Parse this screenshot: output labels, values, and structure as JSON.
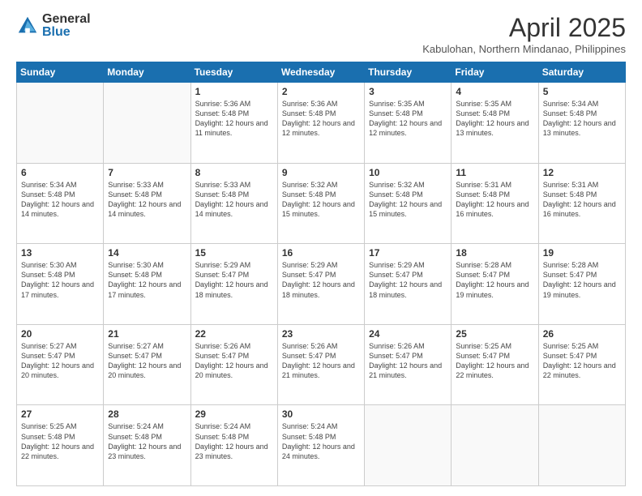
{
  "logo": {
    "general": "General",
    "blue": "Blue"
  },
  "title": "April 2025",
  "location": "Kabulohan, Northern Mindanao, Philippines",
  "days_of_week": [
    "Sunday",
    "Monday",
    "Tuesday",
    "Wednesday",
    "Thursday",
    "Friday",
    "Saturday"
  ],
  "weeks": [
    [
      {
        "day": "",
        "info": ""
      },
      {
        "day": "",
        "info": ""
      },
      {
        "day": "1",
        "info": "Sunrise: 5:36 AM\nSunset: 5:48 PM\nDaylight: 12 hours and 11 minutes."
      },
      {
        "day": "2",
        "info": "Sunrise: 5:36 AM\nSunset: 5:48 PM\nDaylight: 12 hours and 12 minutes."
      },
      {
        "day": "3",
        "info": "Sunrise: 5:35 AM\nSunset: 5:48 PM\nDaylight: 12 hours and 12 minutes."
      },
      {
        "day": "4",
        "info": "Sunrise: 5:35 AM\nSunset: 5:48 PM\nDaylight: 12 hours and 13 minutes."
      },
      {
        "day": "5",
        "info": "Sunrise: 5:34 AM\nSunset: 5:48 PM\nDaylight: 12 hours and 13 minutes."
      }
    ],
    [
      {
        "day": "6",
        "info": "Sunrise: 5:34 AM\nSunset: 5:48 PM\nDaylight: 12 hours and 14 minutes."
      },
      {
        "day": "7",
        "info": "Sunrise: 5:33 AM\nSunset: 5:48 PM\nDaylight: 12 hours and 14 minutes."
      },
      {
        "day": "8",
        "info": "Sunrise: 5:33 AM\nSunset: 5:48 PM\nDaylight: 12 hours and 14 minutes."
      },
      {
        "day": "9",
        "info": "Sunrise: 5:32 AM\nSunset: 5:48 PM\nDaylight: 12 hours and 15 minutes."
      },
      {
        "day": "10",
        "info": "Sunrise: 5:32 AM\nSunset: 5:48 PM\nDaylight: 12 hours and 15 minutes."
      },
      {
        "day": "11",
        "info": "Sunrise: 5:31 AM\nSunset: 5:48 PM\nDaylight: 12 hours and 16 minutes."
      },
      {
        "day": "12",
        "info": "Sunrise: 5:31 AM\nSunset: 5:48 PM\nDaylight: 12 hours and 16 minutes."
      }
    ],
    [
      {
        "day": "13",
        "info": "Sunrise: 5:30 AM\nSunset: 5:48 PM\nDaylight: 12 hours and 17 minutes."
      },
      {
        "day": "14",
        "info": "Sunrise: 5:30 AM\nSunset: 5:48 PM\nDaylight: 12 hours and 17 minutes."
      },
      {
        "day": "15",
        "info": "Sunrise: 5:29 AM\nSunset: 5:47 PM\nDaylight: 12 hours and 18 minutes."
      },
      {
        "day": "16",
        "info": "Sunrise: 5:29 AM\nSunset: 5:47 PM\nDaylight: 12 hours and 18 minutes."
      },
      {
        "day": "17",
        "info": "Sunrise: 5:29 AM\nSunset: 5:47 PM\nDaylight: 12 hours and 18 minutes."
      },
      {
        "day": "18",
        "info": "Sunrise: 5:28 AM\nSunset: 5:47 PM\nDaylight: 12 hours and 19 minutes."
      },
      {
        "day": "19",
        "info": "Sunrise: 5:28 AM\nSunset: 5:47 PM\nDaylight: 12 hours and 19 minutes."
      }
    ],
    [
      {
        "day": "20",
        "info": "Sunrise: 5:27 AM\nSunset: 5:47 PM\nDaylight: 12 hours and 20 minutes."
      },
      {
        "day": "21",
        "info": "Sunrise: 5:27 AM\nSunset: 5:47 PM\nDaylight: 12 hours and 20 minutes."
      },
      {
        "day": "22",
        "info": "Sunrise: 5:26 AM\nSunset: 5:47 PM\nDaylight: 12 hours and 20 minutes."
      },
      {
        "day": "23",
        "info": "Sunrise: 5:26 AM\nSunset: 5:47 PM\nDaylight: 12 hours and 21 minutes."
      },
      {
        "day": "24",
        "info": "Sunrise: 5:26 AM\nSunset: 5:47 PM\nDaylight: 12 hours and 21 minutes."
      },
      {
        "day": "25",
        "info": "Sunrise: 5:25 AM\nSunset: 5:47 PM\nDaylight: 12 hours and 22 minutes."
      },
      {
        "day": "26",
        "info": "Sunrise: 5:25 AM\nSunset: 5:47 PM\nDaylight: 12 hours and 22 minutes."
      }
    ],
    [
      {
        "day": "27",
        "info": "Sunrise: 5:25 AM\nSunset: 5:48 PM\nDaylight: 12 hours and 22 minutes."
      },
      {
        "day": "28",
        "info": "Sunrise: 5:24 AM\nSunset: 5:48 PM\nDaylight: 12 hours and 23 minutes."
      },
      {
        "day": "29",
        "info": "Sunrise: 5:24 AM\nSunset: 5:48 PM\nDaylight: 12 hours and 23 minutes."
      },
      {
        "day": "30",
        "info": "Sunrise: 5:24 AM\nSunset: 5:48 PM\nDaylight: 12 hours and 24 minutes."
      },
      {
        "day": "",
        "info": ""
      },
      {
        "day": "",
        "info": ""
      },
      {
        "day": "",
        "info": ""
      }
    ]
  ]
}
